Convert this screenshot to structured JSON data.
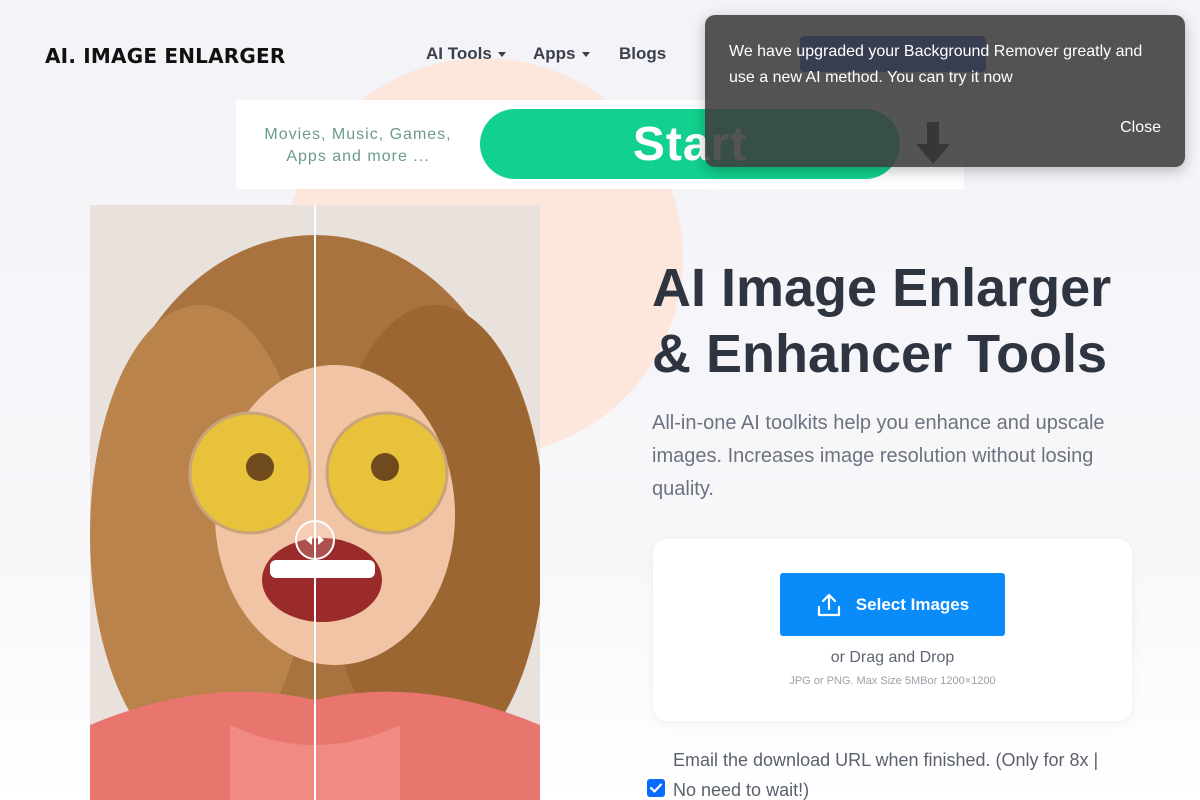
{
  "header": {
    "logo": "AI. IMAGE ENLARGER",
    "nav": [
      {
        "label": "AI Tools",
        "dropdown": true
      },
      {
        "label": "Apps",
        "dropdown": true
      },
      {
        "label": "Blogs",
        "dropdown": false
      }
    ]
  },
  "ad": {
    "line1": "Movies, Music, Games,",
    "line2": "Apps and more ...",
    "start": "Start",
    "icon": "download-arrow-icon"
  },
  "hero": {
    "title_line1": "AI Image Enlarger",
    "title_line2": "& Enhancer Tools",
    "subtitle": "All-in-one AI toolkits help you enhance and upscale images. Increases image resolution without losing quality."
  },
  "upload": {
    "button_label": "Select Images",
    "button_icon": "upload-icon",
    "drag_text": "or Drag and Drop",
    "limits": "JPG or PNG. Max Size 5MBor 1200×1200"
  },
  "email_option": {
    "checked": true,
    "text": "Email the download URL when finished. (Only for 8x | No need to wait!)"
  },
  "toast": {
    "message": "We have upgraded your Background Remover greatly and use a new AI method. You can try it now",
    "close_label": "Close"
  },
  "colors": {
    "accent": "#0a8bfa",
    "ad_green": "#12d18e",
    "blob": "#fde6dc",
    "toast_bg": "#3c3c3c"
  }
}
